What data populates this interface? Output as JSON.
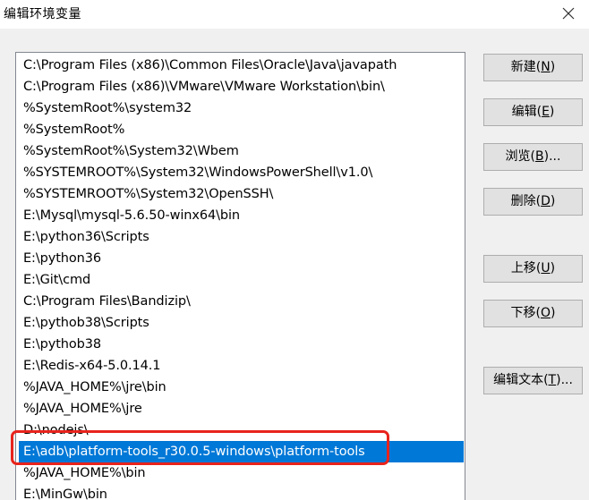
{
  "window": {
    "title": "编辑环境变量",
    "close_icon": "close-icon"
  },
  "path_list": {
    "items": [
      "C:\\Program Files (x86)\\Common Files\\Oracle\\Java\\javapath",
      "C:\\Program Files (x86)\\VMware\\VMware Workstation\\bin\\",
      "%SystemRoot%\\system32",
      "%SystemRoot%",
      "%SystemRoot%\\System32\\Wbem",
      "%SYSTEMROOT%\\System32\\WindowsPowerShell\\v1.0\\",
      "%SYSTEMROOT%\\System32\\OpenSSH\\",
      "E:\\Mysql\\mysql-5.6.50-winx64\\bin",
      "E:\\python36\\Scripts",
      "E:\\python36",
      "E:\\Git\\cmd",
      "C:\\Program Files\\Bandizip\\",
      "E:\\pythob38\\Scripts",
      "E:\\pythob38",
      "E:\\Redis-x64-5.0.14.1",
      "%JAVA_HOME%\\jre\\bin",
      "%JAVA_HOME%\\jre",
      "D:\\nodejs\\",
      "E:\\adb\\platform-tools_r30.0.5-windows\\platform-tools",
      "%JAVA_HOME%\\bin",
      "E:\\MinGw\\bin"
    ],
    "selected_index": 18,
    "selection_color": "#0078d7",
    "annotation_color": "#e8231c"
  },
  "buttons": {
    "new": {
      "label": "新建(",
      "key": "N",
      "end": ")"
    },
    "edit": {
      "label": "编辑(",
      "key": "E",
      "end": ")"
    },
    "browse": {
      "label": "浏览(",
      "key": "B",
      "end": ")..."
    },
    "delete": {
      "label": "删除(",
      "key": "D",
      "end": ")"
    },
    "move_up": {
      "label": "上移(",
      "key": "U",
      "end": ")"
    },
    "move_down": {
      "label": "下移(",
      "key": "O",
      "end": ")"
    },
    "edit_text": {
      "label": "编辑文本(",
      "key": "T",
      "end": ")..."
    }
  }
}
